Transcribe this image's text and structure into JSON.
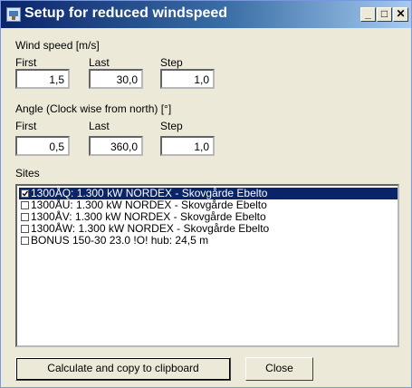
{
  "window": {
    "title": "Setup for reduced windspeed",
    "controls": {
      "minimize": "_",
      "maximize": "□",
      "close": "✕"
    }
  },
  "wind_speed": {
    "heading": "Wind speed [m/s]",
    "first_label": "First",
    "last_label": "Last",
    "step_label": "Step",
    "first_value": "1,5",
    "last_value": "30,0",
    "step_value": "1,0"
  },
  "angle": {
    "heading": "Angle (Clock wise from north) [°]",
    "first_label": "First",
    "last_label": "Last",
    "step_label": "Step",
    "first_value": "0,5",
    "last_value": "360,0",
    "step_value": "1,0"
  },
  "sites": {
    "heading": "Sites",
    "items": [
      {
        "label": "1300ÅQ: 1.300 kW NORDEX - Skovgårde Ebelto",
        "checked": true,
        "selected": true
      },
      {
        "label": "1300ÅU: 1.300 kW NORDEX - Skovgårde Ebelto",
        "checked": false,
        "selected": false
      },
      {
        "label": "1300ÅV: 1.300 kW NORDEX - Skovgårde Ebelto",
        "checked": false,
        "selected": false
      },
      {
        "label": "1300ÅW: 1.300 kW NORDEX - Skovgårde Ebelto",
        "checked": false,
        "selected": false
      },
      {
        "label": "BONUS 150-30 23.0 !O! hub: 24,5 m",
        "checked": false,
        "selected": false
      }
    ]
  },
  "buttons": {
    "calculate": "Calculate and copy to clipboard",
    "close": "Close"
  }
}
